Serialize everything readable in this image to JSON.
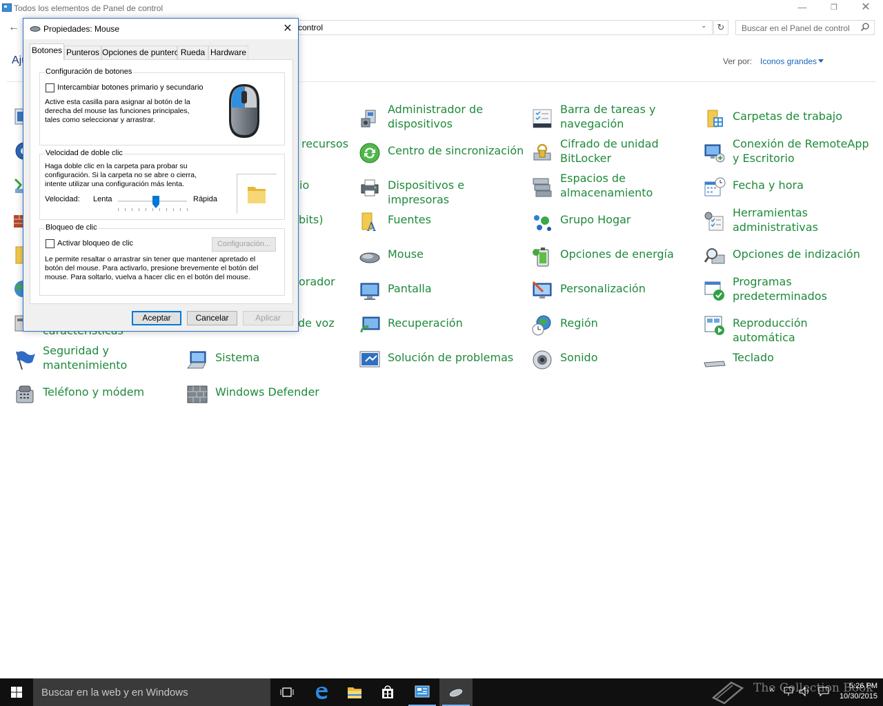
{
  "window": {
    "title": "Todos los elementos de Panel de control",
    "min": "—",
    "max": "❐",
    "close": "✕"
  },
  "toolbar": {
    "back": "←",
    "address_text": "control",
    "address_dropdown": "⌄",
    "refresh": "↻",
    "search_placeholder": "Buscar en el Panel de control"
  },
  "content": {
    "heading": "Aju",
    "view_by_label": "Ver por:",
    "view_by_value": "Iconos grandes"
  },
  "partial_items": [
    "recursos",
    "io",
    "bits)",
    "orador",
    "de voz",
    "características"
  ],
  "items": [
    {
      "label": "Administrador de dispositivos",
      "icon": "device-manager-icon"
    },
    {
      "label": "Barra de tareas y navegación",
      "icon": "taskbar-icon"
    },
    {
      "label": "Carpetas de trabajo",
      "icon": "work-folders-icon"
    },
    {
      "label": "Centro de sincronización",
      "icon": "sync-center-icon"
    },
    {
      "label": "Cifrado de unidad BitLocker",
      "icon": "bitlocker-icon"
    },
    {
      "label": "Conexión de RemoteApp y Escritorio",
      "icon": "remoteapp-icon"
    },
    {
      "label": "Dispositivos e impresoras",
      "icon": "printer-icon"
    },
    {
      "label": "Espacios de almacenamiento",
      "icon": "storage-spaces-icon"
    },
    {
      "label": "Fecha y hora",
      "icon": "calendar-clock-icon"
    },
    {
      "label": "Fuentes",
      "icon": "fonts-icon"
    },
    {
      "label": "Grupo Hogar",
      "icon": "homegroup-icon"
    },
    {
      "label": "Herramientas administrativas",
      "icon": "admin-tools-icon"
    },
    {
      "label": "Mouse",
      "icon": "mouse-icon"
    },
    {
      "label": "Opciones de energía",
      "icon": "power-options-icon"
    },
    {
      "label": "Opciones de indización",
      "icon": "indexing-icon"
    },
    {
      "label": "Pantalla",
      "icon": "display-icon"
    },
    {
      "label": "Personalización",
      "icon": "personalization-icon"
    },
    {
      "label": "Programas predeterminados",
      "icon": "default-programs-icon"
    },
    {
      "label": "Recuperación",
      "icon": "recovery-icon"
    },
    {
      "label": "Región",
      "icon": "region-globe-icon"
    },
    {
      "label": "Reproducción automática",
      "icon": "autoplay-icon"
    },
    {
      "label": "Seguridad y mantenimiento",
      "icon": "security-flag-icon"
    },
    {
      "label": "Sistema",
      "icon": "system-icon"
    },
    {
      "label": "Solución de problemas",
      "icon": "troubleshoot-icon"
    },
    {
      "label": "Sonido",
      "icon": "sound-icon"
    },
    {
      "label": "Teclado",
      "icon": "keyboard-icon"
    },
    {
      "label": "Teléfono y módem",
      "icon": "phone-modem-icon"
    },
    {
      "label": "Windows Defender",
      "icon": "windows-defender-icon"
    }
  ],
  "dialog": {
    "title": "Propiedades: Mouse",
    "close": "✕",
    "tabs": [
      "Botones",
      "Punteros",
      "Opciones de puntero",
      "Rueda",
      "Hardware"
    ],
    "active_tab": "Botones",
    "buttons_group": {
      "title": "Configuración de botones",
      "checkbox_label": "Intercambiar botones primario y secundario",
      "checked": false,
      "description": [
        "Active esta casilla para asignar al botón de la",
        "derecha del mouse las funciones principales,",
        "tales como seleccionar y arrastrar."
      ]
    },
    "double_click_group": {
      "title": "Velocidad de doble clic",
      "description": [
        "Haga doble clic en la carpeta para probar su",
        "configuración. Si la carpeta no se abre o cierra,",
        "intente utilizar una configuración más lenta."
      ],
      "speed_label": "Velocidad:",
      "slow_label": "Lenta",
      "fast_label": "Rápida",
      "slider_position": 0.55
    },
    "click_lock_group": {
      "title": "Bloqueo de clic",
      "checkbox_label": "Activar bloqueo de clic",
      "checked": false,
      "settings_button": "Configuración...",
      "description": [
        "Le permite resaltar o arrastrar sin tener que mantener apretado el",
        "botón del mouse. Para activarlo, presione brevemente el botón del",
        "mouse. Para soltarlo, vuelva a hacer clic en el botón del mouse."
      ]
    },
    "ok": "Aceptar",
    "cancel": "Cancelar",
    "apply": "Aplicar"
  },
  "taskbar": {
    "search_placeholder": "Buscar en la web y en Windows",
    "watermark": "The Collection Book",
    "time": "5:26 PM",
    "date": "10/30/2015"
  },
  "colors": {
    "item_text": "#1e8a3a",
    "accent": "#0078d7",
    "link": "#1a65b8"
  }
}
